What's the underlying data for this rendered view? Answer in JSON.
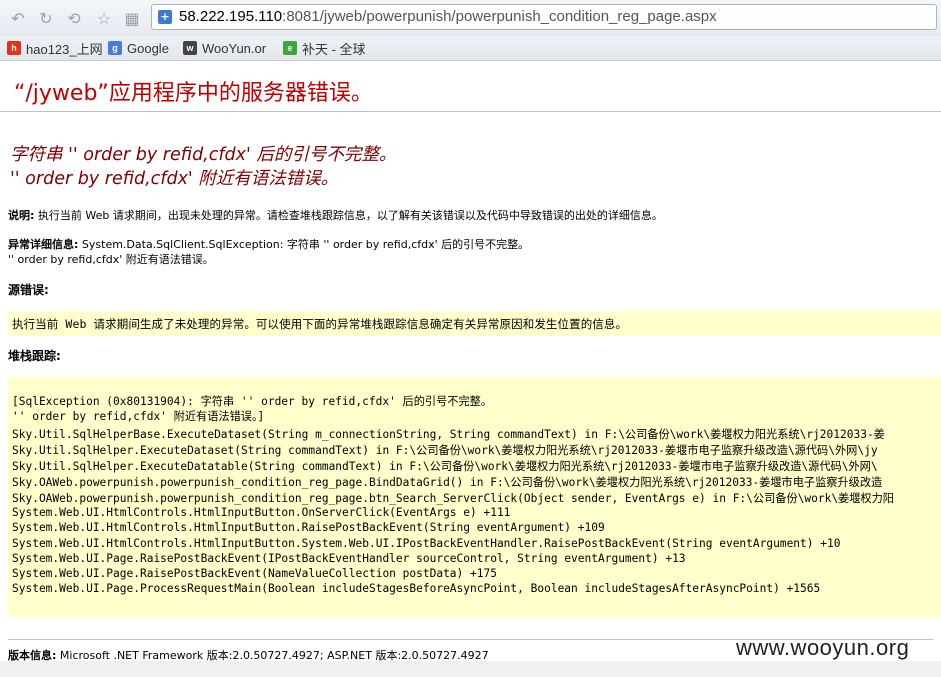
{
  "browser": {
    "url_host": "58.222.195.110",
    "url_rest": ":8081/jyweb/powerpunish/powerpunish_condition_reg_page.aspx",
    "bookmarks": [
      {
        "label": "hao123_上网",
        "icon": "hao123-icon",
        "color": "#e0321c"
      },
      {
        "label": "Google",
        "icon": "google-icon",
        "color": "#4a7be0"
      },
      {
        "label": "WooYun.or",
        "icon": "wooyun-icon",
        "color": "#444444"
      },
      {
        "label": "补天 - 全球",
        "icon": "butian-icon",
        "color": "#3ca53c"
      }
    ]
  },
  "page": {
    "title": "“/jyweb”应用程序中的服务器错误。",
    "error_line1": "字符串 ''  order by  refid,cfdx' 后的引号不完整。",
    "error_line2": "''  order by  refid,cfdx' 附近有语法错误。",
    "desc_label": "说明:",
    "desc_text": " 执行当前 Web 请求期间，出现未处理的异常。请检查堆栈跟踪信息，以了解有关该错误以及代码中导致错误的出处的详细信息。",
    "exception_label": "异常详细信息:",
    "exception_text": " System.Data.SqlClient.SqlException: 字符串 ''  order by  refid,cfdx' 后的引号不完整。",
    "exception_text2": "''  order by  refid,cfdx' 附近有语法错误。",
    "source_label": "源错误:",
    "source_text": "执行当前 Web 请求期间生成了未处理的异常。可以使用下面的异常堆栈跟踪信息确定有关异常原因和发生位置的信息。",
    "stack_label": "堆栈跟踪:",
    "stack_lines": [
      "[SqlException (0x80131904): 字符串 ''  order by  refid,cfdx' 后的引号不完整。",
      "''  order by  refid,cfdx' 附近有语法错误。]",
      "   Sky.Util.SqlHelperBase.ExecuteDataset(String m_connectionString, String commandText) in F:\\公司备份\\work\\姜堰权力阳光系统\\rj2012033-姜",
      "   Sky.Util.SqlHelper.ExecuteDataset(String commandText) in F:\\公司备份\\work\\姜堰权力阳光系统\\rj2012033-姜堰市电子监察升级改造\\源代码\\外网\\jy",
      "   Sky.Util.SqlHelper.ExecuteDatatable(String commandText) in F:\\公司备份\\work\\姜堰权力阳光系统\\rj2012033-姜堰市电子监察升级改造\\源代码\\外网\\",
      "   Sky.OAWeb.powerpunish.powerpunish_condition_reg_page.BindDataGrid() in F:\\公司备份\\work\\姜堰权力阳光系统\\rj2012033-姜堰市电子监察升级改造",
      "   Sky.OAWeb.powerpunish.powerpunish_condition_reg_page.btn_Search_ServerClick(Object sender, EventArgs e) in F:\\公司备份\\work\\姜堰权力阳",
      "   System.Web.UI.HtmlControls.HtmlInputButton.OnServerClick(EventArgs e) +111",
      "   System.Web.UI.HtmlControls.HtmlInputButton.RaisePostBackEvent(String eventArgument) +109",
      "   System.Web.UI.HtmlControls.HtmlInputButton.System.Web.UI.IPostBackEventHandler.RaisePostBackEvent(String eventArgument) +10",
      "   System.Web.UI.Page.RaisePostBackEvent(IPostBackEventHandler sourceControl, String eventArgument) +13",
      "   System.Web.UI.Page.RaisePostBackEvent(NameValueCollection postData) +175",
      "   System.Web.UI.Page.ProcessRequestMain(Boolean includeStagesBeforeAsyncPoint, Boolean includeStagesAfterAsyncPoint) +1565"
    ],
    "version_label": "版本信息:",
    "version_text": " Microsoft .NET Framework 版本:2.0.50727.4927; ASP.NET 版本:2.0.50727.4927",
    "watermark": "www.wooyun.org"
  }
}
